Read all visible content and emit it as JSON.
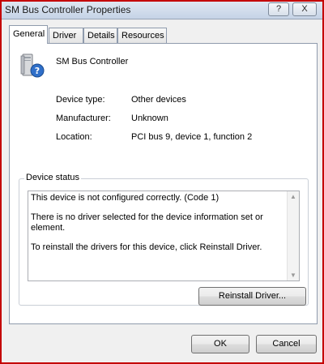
{
  "window": {
    "title": "SM Bus Controller Properties",
    "help_label": "?",
    "close_label": "X"
  },
  "tabs": [
    {
      "label": "General",
      "active": true
    },
    {
      "label": "Driver",
      "active": false
    },
    {
      "label": "Details",
      "active": false
    },
    {
      "label": "Resources",
      "active": false
    }
  ],
  "device": {
    "name": "SM Bus Controller",
    "icon": "device-question-icon"
  },
  "properties": {
    "type_label": "Device type:",
    "type_value": "Other devices",
    "manufacturer_label": "Manufacturer:",
    "manufacturer_value": "Unknown",
    "location_label": "Location:",
    "location_value": "PCI bus 9, device 1, function 2"
  },
  "status": {
    "group_label": "Device status",
    "line1": "This device is not configured correctly. (Code 1)",
    "line2": "There is no driver selected for the device information set or element.",
    "line3": "To reinstall the drivers for this device, click Reinstall Driver.",
    "reinstall_label": "Reinstall Driver..."
  },
  "footer": {
    "ok_label": "OK",
    "cancel_label": "Cancel"
  },
  "colors": {
    "highlight_border": "#c40000",
    "dialog_background": "#f0f0f0"
  }
}
